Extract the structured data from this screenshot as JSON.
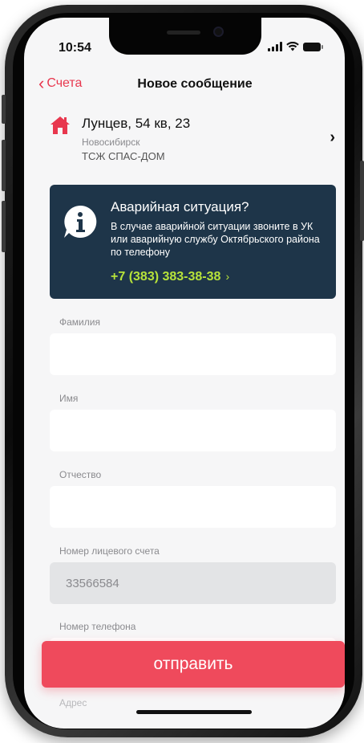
{
  "status_bar": {
    "time": "10:54"
  },
  "nav": {
    "back_label": "Счета",
    "title": "Новое сообщение"
  },
  "address": {
    "street": "Лунцев, 54 кв, 23",
    "city": "Новосибирск",
    "organization": "ТСЖ СПАС-ДОМ",
    "icon": "house-icon",
    "icon_color": "#e8374e"
  },
  "emergency": {
    "title": "Аварийная ситуация?",
    "text": "В случае аварийной ситуации звоните в УК или аварийную службу Октябрьского района по телефону",
    "phone": "+7 (383) 383-38-38",
    "phone_arrow": "›",
    "background": "#1e3549",
    "phone_color": "#b7e33a"
  },
  "form": {
    "last_name": {
      "label": "Фамилия",
      "value": ""
    },
    "first_name": {
      "label": "Имя",
      "value": ""
    },
    "patronymic": {
      "label": "Отчество",
      "value": ""
    },
    "account_number": {
      "label": "Номер лицевого счета",
      "value": "33566584"
    },
    "phone_number": {
      "label": "Номер телефона",
      "value": ""
    },
    "next_label": "Адрес"
  },
  "submit": {
    "label": "отправить",
    "color": "#ef4a5c"
  }
}
